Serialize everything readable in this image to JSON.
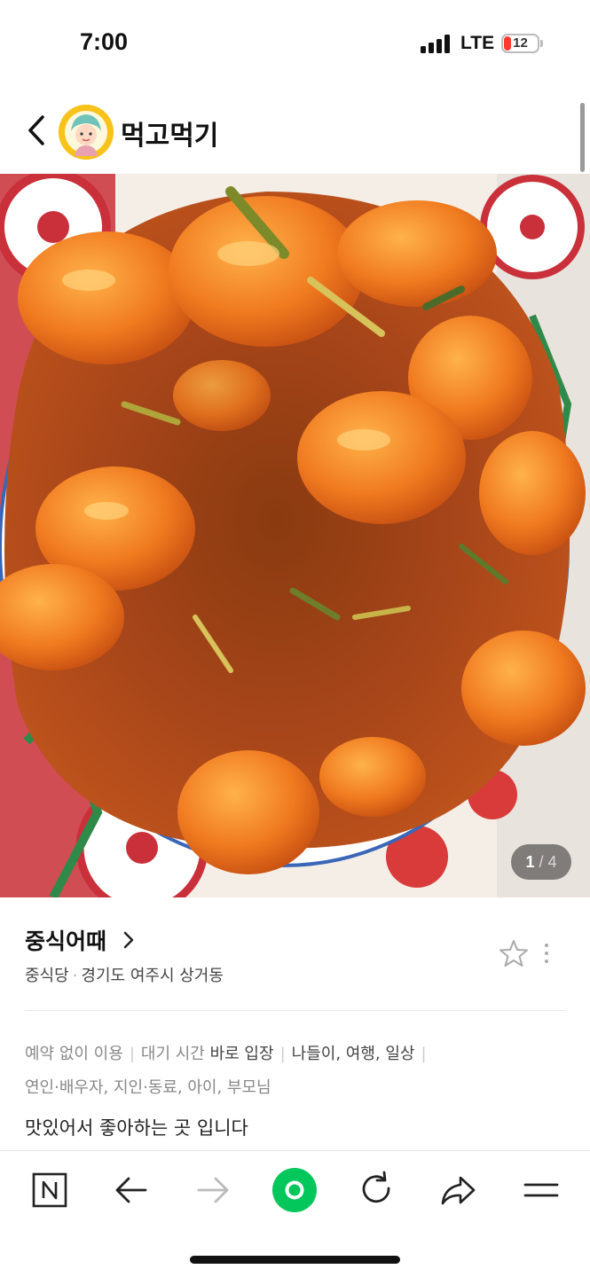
{
  "status_bar": {
    "time": "7:00",
    "network": "LTE",
    "battery_level": "12",
    "battery_color": "#ff3b30"
  },
  "header": {
    "back_icon": "chevron-left-icon",
    "blog_name": "먹고먹기",
    "avatar_bg": "#f7c21a"
  },
  "photo": {
    "current": "1",
    "separator": "/",
    "total": "4"
  },
  "place": {
    "name": "중식어때",
    "category": "중식당",
    "separator": "·",
    "address": "경기도 여주시 상거동"
  },
  "tags": {
    "reservation": "예약 없이 이용",
    "wait_label": "대기 시간",
    "wait_value": "바로 입장",
    "purpose": "나들이, 여행, 일상",
    "companions": "연인·배우자, 지인·동료, 아이, 부모님"
  },
  "review": {
    "text": "맛있어서 좋아하는 곳 입니다"
  },
  "toolbar": {
    "items": [
      "naver-home-icon",
      "back-arrow-icon",
      "forward-arrow-icon",
      "green-dot-icon",
      "refresh-icon",
      "share-icon",
      "menu-icon"
    ],
    "accent": "#03c75a"
  }
}
